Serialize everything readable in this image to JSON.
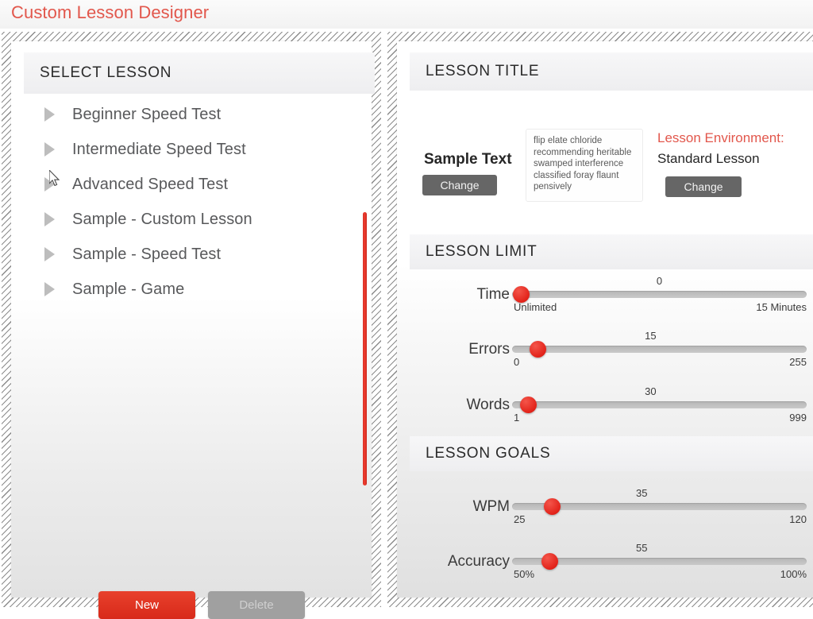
{
  "app": {
    "title": "Custom Lesson Designer",
    "accent_color": "#e2574c",
    "red_button_color": "#d8291a"
  },
  "left_panel": {
    "header": "SELECT LESSON",
    "lessons": [
      {
        "label": "Beginner Speed Test"
      },
      {
        "label": "Intermediate Speed Test"
      },
      {
        "label": "Advanced Speed Test"
      },
      {
        "label": "Sample - Custom Lesson"
      },
      {
        "label": "Sample - Speed Test"
      },
      {
        "label": "Sample - Game"
      }
    ],
    "buttons": {
      "new_label": "New",
      "delete_label": "Delete"
    }
  },
  "right_panel": {
    "title_section": {
      "header": "LESSON TITLE",
      "sample_text_label": "Sample Text",
      "sample_text_change_label": "Change",
      "sample_text_preview": "flip elate chloride recommending heritable swamped interference classified foray flaunt pensively",
      "environment_label": "Lesson Environment:",
      "environment_value": "Standard Lesson",
      "environment_change_label": "Change"
    },
    "limit_section": {
      "header": "LESSON LIMIT",
      "sliders": [
        {
          "name": "Time",
          "value": "0",
          "min": "Unlimited",
          "max": "15 Minutes",
          "fill": 0.03
        },
        {
          "name": "Errors",
          "value": "15",
          "min": "0",
          "max": "255",
          "fill": 0.085
        },
        {
          "name": "Words",
          "value": "30",
          "min": "1",
          "max": "999",
          "fill": 0.055
        }
      ]
    },
    "goals_section": {
      "header": "LESSON GOALS",
      "sliders": [
        {
          "name": "WPM",
          "value": "35",
          "min": "25",
          "max": "120",
          "fill": 0.135
        },
        {
          "name": "Accuracy",
          "value": "55",
          "min": "50%",
          "max": "100%",
          "fill": 0.128
        }
      ]
    }
  }
}
